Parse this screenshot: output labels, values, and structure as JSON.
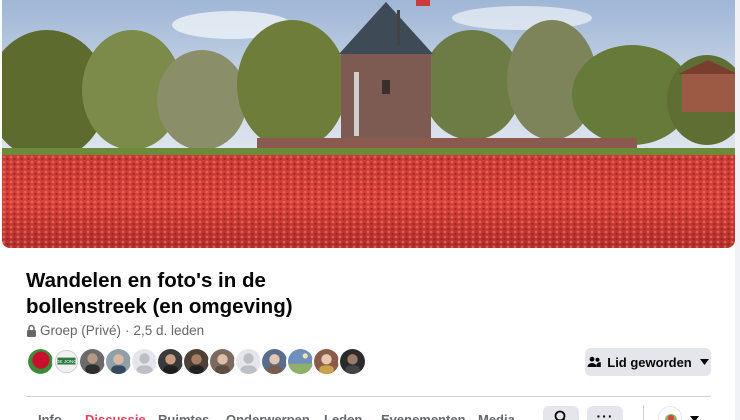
{
  "group": {
    "title": "Wandelen en foto's in de bollenstreek (en omgeving)",
    "privacy": "Groep (Privé)",
    "separator": "·",
    "members": "2,5 d. leden"
  },
  "member_avatars": [
    {
      "name": "avatar-1",
      "color": "#c8102e"
    },
    {
      "name": "avatar-2",
      "color": "#ffffff",
      "text": "DE JONG"
    },
    {
      "name": "avatar-3",
      "color": "#6b6b6b"
    },
    {
      "name": "avatar-4",
      "color": "#8fa0a8"
    },
    {
      "name": "avatar-5",
      "color": "#d8dadf"
    },
    {
      "name": "avatar-6",
      "color": "#3a3a3a"
    },
    {
      "name": "avatar-7",
      "color": "#4d4036"
    },
    {
      "name": "avatar-8",
      "color": "#7a6a60"
    },
    {
      "name": "avatar-9",
      "color": "#d8dadf"
    },
    {
      "name": "avatar-10",
      "color": "#5a6d8a"
    },
    {
      "name": "avatar-11",
      "color": "#6f8fbf"
    },
    {
      "name": "avatar-12",
      "color": "#8a5b4a"
    },
    {
      "name": "avatar-13",
      "color": "#2b2b2b"
    }
  ],
  "join_button": {
    "label": "Lid geworden",
    "icon": "people-icon"
  },
  "tabs": [
    {
      "label": "Info",
      "active": false
    },
    {
      "label": "Discussie",
      "active": true
    },
    {
      "label": "Ruimtes",
      "active": false
    },
    {
      "label": "Onderwerpen",
      "active": false
    },
    {
      "label": "Leden",
      "active": false
    },
    {
      "label": "Evenementen",
      "active": false
    },
    {
      "label": "Media",
      "active": false
    }
  ],
  "toolbar": {
    "search_icon": "search-icon",
    "more_label": "···"
  },
  "colors": {
    "accent_active_tab": "#e4405f",
    "button_bg": "#e4e6eb",
    "meta_text": "#65676b"
  }
}
